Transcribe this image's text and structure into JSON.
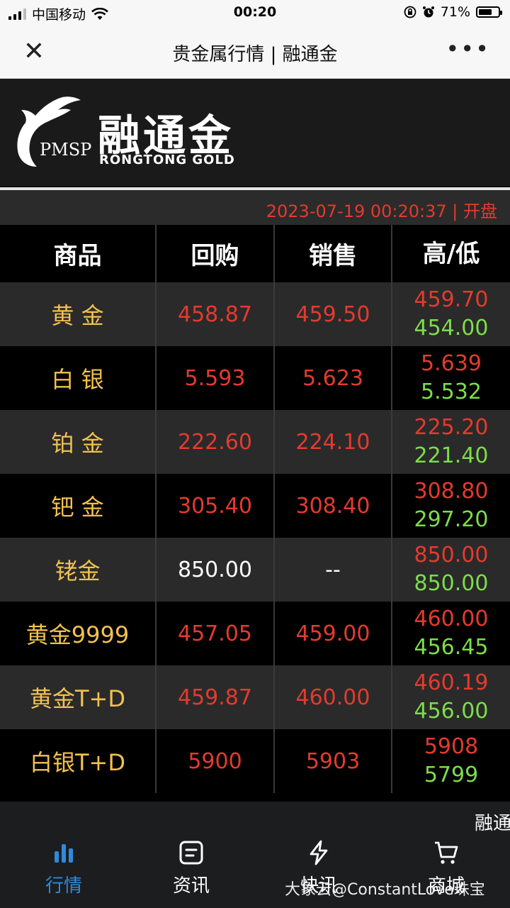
{
  "status_bar": {
    "carrier": "中国移动",
    "time": "00:20",
    "battery_percent": "71%",
    "battery_level": 0.71
  },
  "nav": {
    "title": "贵金属行情 | 融通金",
    "close_icon": "close-icon",
    "more_icon": "more-dots-icon"
  },
  "banner": {
    "logo_cn": "融通金",
    "logo_en": "RONGTONG GOLD",
    "logo_abbr": "PMSP"
  },
  "timestamp": "2023-07-19 00:20:37 | 开盘",
  "table": {
    "headers": [
      "商品",
      "回购",
      "销售",
      "高/低"
    ],
    "rows": [
      {
        "name": "黄 金",
        "buyback": "458.87",
        "sale": "459.50",
        "high": "459.70",
        "low": "454.00"
      },
      {
        "name": "白 银",
        "buyback": "5.593",
        "sale": "5.623",
        "high": "5.639",
        "low": "5.532"
      },
      {
        "name": "铂 金",
        "buyback": "222.60",
        "sale": "224.10",
        "high": "225.20",
        "low": "221.40"
      },
      {
        "name": "钯 金",
        "buyback": "305.40",
        "sale": "308.40",
        "high": "308.80",
        "low": "297.20"
      },
      {
        "name": "铑金",
        "buyback": "850.00",
        "sale": "--",
        "high": "850.00",
        "low": "850.00"
      },
      {
        "name": "黄金9999",
        "buyback": "457.05",
        "sale": "459.00",
        "high": "460.00",
        "low": "456.45"
      },
      {
        "name": "黄金T+D",
        "buyback": "459.87",
        "sale": "460.00",
        "high": "460.19",
        "low": "456.00"
      },
      {
        "name": "白银T+D",
        "buyback": "5900",
        "sale": "5903",
        "high": "5908",
        "low": "5799"
      }
    ]
  },
  "ticker_text": "融通",
  "tabs": [
    {
      "label": "行情",
      "icon": "bar-chart-icon",
      "active": true
    },
    {
      "label": "资讯",
      "icon": "news-icon",
      "active": false
    },
    {
      "label": "快讯",
      "icon": "lightning-icon",
      "active": false
    },
    {
      "label": "商城",
      "icon": "cart-icon",
      "active": false
    }
  ],
  "watermark": "大象云@ConstantLove珠宝",
  "colors": {
    "up_red": "#e53a2e",
    "low_green": "#7ddd4a",
    "name_gold": "#f2c14f",
    "active_blue": "#2e8bdc"
  }
}
